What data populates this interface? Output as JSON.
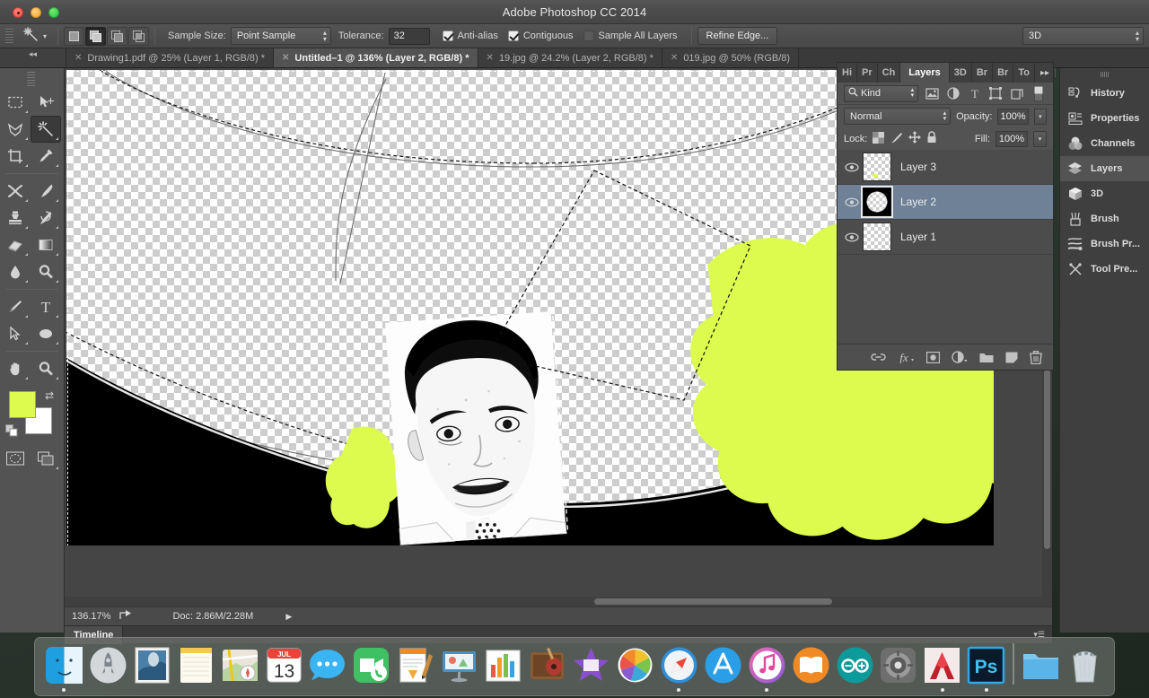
{
  "window": {
    "title": "Adobe Photoshop CC 2014",
    "traffic_lights": [
      "close-red",
      "minimize-yellow",
      "maximize-green"
    ]
  },
  "options_bar": {
    "tool_icon": "magic-wand-icon",
    "tool_preset_caret": "caret-down-icon",
    "selection_modes": [
      {
        "name": "new-selection",
        "icon": "square-icon",
        "active": false
      },
      {
        "name": "add-to-selection",
        "icon": "two-squares-union-icon",
        "active": true
      },
      {
        "name": "subtract-from-selection",
        "icon": "two-squares-subtract-icon",
        "active": false
      },
      {
        "name": "intersect-selection",
        "icon": "two-squares-intersect-icon",
        "active": false
      }
    ],
    "sample_size_label": "Sample Size:",
    "sample_size_value": "Point Sample",
    "tolerance_label": "Tolerance:",
    "tolerance_value": "32",
    "anti_alias_label": "Anti-alias",
    "anti_alias_checked": true,
    "contiguous_label": "Contiguous",
    "contiguous_checked": true,
    "sample_all_layers_label": "Sample All Layers",
    "sample_all_layers_checked": false,
    "refine_edge_label": "Refine Edge...",
    "workspace_value": "3D"
  },
  "document_tabs": [
    {
      "label": "Drawing1.pdf @ 25% (Layer 1, RGB/8) *",
      "active": false
    },
    {
      "label": "Untitled–1 @ 136% (Layer 2, RGB/8) *",
      "active": true
    },
    {
      "label": "19.jpg @ 24.2% (Layer 2, RGB/8) *",
      "active": false
    },
    {
      "label": "019.jpg @ 50% (RGB/8)",
      "active": false
    }
  ],
  "toolbar": {
    "tools": [
      {
        "name": "rectangular-marquee-tool",
        "icon": "dashed-rectangle-icon",
        "selected": false
      },
      {
        "name": "move-tool",
        "icon": "arrow-move-icon",
        "selected": false
      },
      {
        "name": "lasso-tool",
        "icon": "lasso-icon",
        "selected": false
      },
      {
        "name": "magic-wand-tool",
        "icon": "magic-wand-icon",
        "selected": true
      },
      {
        "name": "crop-tool",
        "icon": "crop-icon",
        "selected": false
      },
      {
        "name": "eyedropper-tool",
        "icon": "eyedropper-icon",
        "selected": false
      },
      {
        "name": "spot-healing-brush-tool",
        "icon": "healing-brush-icon",
        "selected": false
      },
      {
        "name": "brush-tool",
        "icon": "paintbrush-icon",
        "selected": false
      },
      {
        "name": "clone-stamp-tool",
        "icon": "clone-stamp-icon",
        "selected": false
      },
      {
        "name": "history-brush-tool",
        "icon": "history-brush-icon",
        "selected": false
      },
      {
        "name": "eraser-tool",
        "icon": "eraser-icon",
        "selected": false
      },
      {
        "name": "gradient-tool",
        "icon": "gradient-icon",
        "selected": false
      },
      {
        "name": "blur-tool",
        "icon": "water-drop-icon",
        "selected": false
      },
      {
        "name": "dodge-tool",
        "icon": "dodge-icon",
        "selected": false
      },
      {
        "name": "pen-tool",
        "icon": "pen-icon",
        "selected": false
      },
      {
        "name": "type-tool",
        "icon": "text-t-icon",
        "selected": false
      },
      {
        "name": "path-selection-tool",
        "icon": "path-arrow-icon",
        "selected": false
      },
      {
        "name": "ellipse-tool",
        "icon": "ellipse-icon",
        "selected": false
      },
      {
        "name": "hand-tool",
        "icon": "hand-icon",
        "selected": false
      },
      {
        "name": "zoom-tool",
        "icon": "magnifier-icon",
        "selected": false
      }
    ],
    "foreground_color": "#DCFB4E",
    "background_color": "#FFFFFF",
    "swap_icon": "swap-colors-icon",
    "default_colors_icon": "default-colors-icon",
    "quick_mask_icon": "quick-mask-icon",
    "screen_mode_icon": "screen-mode-icon"
  },
  "canvas": {
    "artwork_green": "#DCFB4E",
    "checker_light": "#FFFFFF",
    "checker_dark": "#CDCDCD",
    "selection_style": "marching-ants"
  },
  "status_bar": {
    "zoom": "136.17%",
    "share_icon": "share-icon",
    "doc_info": "Doc: 2.86M/2.28M",
    "expand_icon": "triangle-right-icon"
  },
  "timeline_bar": {
    "tab_label": "Timeline",
    "menu_icon": "panel-menu-icon"
  },
  "layers_panel": {
    "tabs": [
      {
        "label": "Hi",
        "name": "history",
        "active": false
      },
      {
        "label": "Pr",
        "name": "properties",
        "active": false
      },
      {
        "label": "Ch",
        "name": "channels",
        "active": false
      },
      {
        "label": "Layers",
        "name": "layers",
        "active": true
      },
      {
        "label": "3D",
        "name": "three-d",
        "active": false
      },
      {
        "label": "Br",
        "name": "brush",
        "active": false
      },
      {
        "label": "Br",
        "name": "brush-presets",
        "active": false
      },
      {
        "label": "To",
        "name": "tool-presets",
        "active": false
      }
    ],
    "overflow_icon": "double-chevron-right-icon",
    "menu_icon": "panel-menu-icon",
    "filter_label": "Kind",
    "filter_search_icon": "search-icon",
    "filter_icons": [
      {
        "name": "filter-pixel-layers-icon"
      },
      {
        "name": "filter-adjustment-layers-icon"
      },
      {
        "name": "filter-type-layers-icon"
      },
      {
        "name": "filter-shape-layers-icon"
      },
      {
        "name": "filter-smart-object-icon"
      }
    ],
    "filter_toggle_icon": "filter-toggle-switch",
    "blend_mode": "Normal",
    "opacity_label": "Opacity:",
    "opacity_value": "100%",
    "lock_label": "Lock:",
    "lock_icons": [
      {
        "name": "lock-transparent-pixels-icon"
      },
      {
        "name": "lock-image-pixels-icon"
      },
      {
        "name": "lock-position-icon"
      },
      {
        "name": "lock-all-icon"
      }
    ],
    "fill_label": "Fill:",
    "fill_value": "100%",
    "layers": [
      {
        "name": "Layer 3",
        "visible": true,
        "selected": false,
        "thumb": "transparent-with-green-stroke"
      },
      {
        "name": "Layer 2",
        "visible": true,
        "selected": true,
        "thumb": "black-square-with-circle"
      },
      {
        "name": "Layer 1",
        "visible": true,
        "selected": false,
        "thumb": "transparent"
      }
    ],
    "footer_icons": [
      {
        "name": "link-layers-icon"
      },
      {
        "name": "layer-style-fx-icon"
      },
      {
        "name": "add-layer-mask-icon"
      },
      {
        "name": "new-adjustment-layer-icon"
      },
      {
        "name": "new-group-icon"
      },
      {
        "name": "new-layer-icon"
      },
      {
        "name": "delete-layer-icon"
      }
    ]
  },
  "right_dock": {
    "items": [
      {
        "label": "History",
        "icon": "history-icon",
        "active": false
      },
      {
        "label": "Properties",
        "icon": "properties-icon",
        "active": false
      },
      {
        "label": "Channels",
        "icon": "channels-icon",
        "active": false
      },
      {
        "label": "Layers",
        "icon": "layers-icon",
        "active": true
      },
      {
        "label": "3D",
        "icon": "cube-icon",
        "active": false
      },
      {
        "label": "Brush",
        "icon": "brush-icon",
        "active": false
      },
      {
        "label": "Brush Pr...",
        "icon": "brush-presets-icon",
        "active": false
      },
      {
        "label": "Tool Pre...",
        "icon": "tool-presets-icon",
        "active": false
      }
    ],
    "collapse_icon": "double-chevron-right-icon"
  },
  "dock": {
    "items": [
      {
        "name": "finder",
        "running": true
      },
      {
        "name": "launchpad",
        "running": false
      },
      {
        "name": "photo-booth",
        "running": false
      },
      {
        "name": "notes",
        "running": false
      },
      {
        "name": "maps",
        "running": false
      },
      {
        "name": "calendar",
        "running": false,
        "day": "13",
        "month": "JUL"
      },
      {
        "name": "messages",
        "running": false
      },
      {
        "name": "facetime",
        "running": false
      },
      {
        "name": "pages",
        "running": false
      },
      {
        "name": "keynote",
        "running": false
      },
      {
        "name": "numbers",
        "running": false
      },
      {
        "name": "garageband",
        "running": false
      },
      {
        "name": "imovie",
        "running": false
      },
      {
        "name": "photos",
        "running": false
      },
      {
        "name": "safari",
        "running": true
      },
      {
        "name": "app-store",
        "running": false
      },
      {
        "name": "itunes",
        "running": true
      },
      {
        "name": "ibooks",
        "running": false
      },
      {
        "name": "arduino",
        "running": false
      },
      {
        "name": "system-preferences",
        "running": false
      },
      {
        "name": "autocad",
        "running": true
      },
      {
        "name": "photoshop",
        "running": true
      },
      {
        "name": "downloads-folder",
        "running": false
      },
      {
        "name": "trash",
        "running": false
      }
    ]
  }
}
